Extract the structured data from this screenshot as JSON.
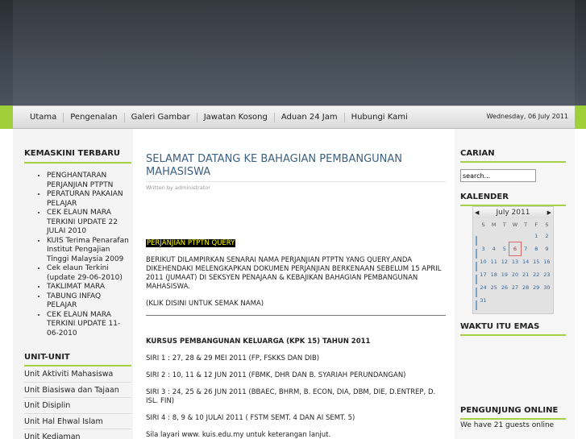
{
  "nav": {
    "items": [
      "Utama",
      "Pengenalan",
      "Galeri Gambar",
      "Jawatan Kosong",
      "Aduan 24 Jam",
      "Hubungi Kami"
    ],
    "date": "Wednesday, 06 July 2011"
  },
  "left": {
    "latest_title": "KEMASKINI TERBARU",
    "latest_items": [
      "PENGHANTARAN PERJANJIAN PTPTN",
      "PERATURAN PAKAIAN PELAJAR",
      "CEK ELAUN MARA TERKINI UPDATE 22 JULAI 2010",
      "KUIS Terima Penarafan Institut Pengajian Tinggi Malaysia 2009",
      "Cek elaun Terkini (update 29-06-2010)",
      "TAKLIMAT MARA",
      "TABUNG INFAQ PELAJAR",
      "CEK ELAUN MARA TERKINI UPDATE 11-06-2010"
    ],
    "units_title": "UNIT-UNIT",
    "units": [
      "Unit Aktiviti Mahasiswa",
      "Unit Biasiswa dan Tajaan",
      "Unit Disiplin",
      "Unit Hal Ehwal Islam",
      "Unit Kediaman"
    ]
  },
  "main": {
    "title": "SELAMAT DATANG KE BAHAGIAN PEMBANGUNAN MAHASISWA",
    "author": "Written by administrator",
    "highlight": "PERJANJIAN PTPTN QUERY",
    "para1": "BERIKUT DILAMPIRKAN SENARAI NAMA PERJANJIAN PTPTN YANG QUERY,ANDA DIKEHENDAKI MELENGKAPKAN DOKUMEN PERJANJIAN BERKENAAN SEBELUM 15 APRIL 2011 (JUMAAT) DI SEKSYEN PENAJAAN & KEBAJIKAN BAHAGIAN PEMBANGUNAN MAHASISWA.",
    "para2": "(KLIK DISINI UNTUK SEMAK NAMA)",
    "course_title": "KURSUS PEMBANGUNAN KELUARGA (KPK 15) TAHUN 2011",
    "siri": [
      "SIRI 1 : 27, 28 & 29 MEI 2011 (FP, FSKKS DAN DIB)",
      "SIRI 2 : 10, 11 & 12 JUN 2011 (FBMK, DHR DAN B. SYARIAH PERUNDANGAN)",
      "SIRI 3 : 24, 25 & 26 JUN 2011 (BBAEC, BHRM, B. ECON, DIA, DBM, DIE, D.ENTREP, D. ISL. FIN)",
      "SIRI 4 : 8, 9 & 10 JULAI 2011 ( FSTM SEMT. 4 DAN AI SEMT. 5)"
    ],
    "footer": "Sila layari www. kuis.edu.my untuk keterangan lanjut."
  },
  "right": {
    "search_title": "CARIAN",
    "search_value": "search...",
    "calendar_title": "KALENDER",
    "calendar": {
      "month": "July 2011",
      "prev": "◀",
      "next": "▶",
      "days": [
        "S",
        "M",
        "T",
        "W",
        "T",
        "F",
        "S"
      ],
      "weeks": [
        [
          "",
          "",
          "",
          "",
          "",
          "1",
          "2"
        ],
        [
          "3",
          "4",
          "5",
          "6",
          "7",
          "8",
          "9"
        ],
        [
          "10",
          "11",
          "12",
          "13",
          "14",
          "15",
          "16"
        ],
        [
          "17",
          "18",
          "19",
          "20",
          "21",
          "22",
          "23"
        ],
        [
          "24",
          "25",
          "26",
          "27",
          "28",
          "29",
          "30"
        ],
        [
          "31",
          "",
          "",
          "",
          "",
          "",
          ""
        ]
      ],
      "today": "6"
    },
    "time_title": "WAKTU ITU EMAS",
    "visitors_title": "PENGUNJUNG ONLINE",
    "visitors_text": "We have 21 guests online"
  }
}
